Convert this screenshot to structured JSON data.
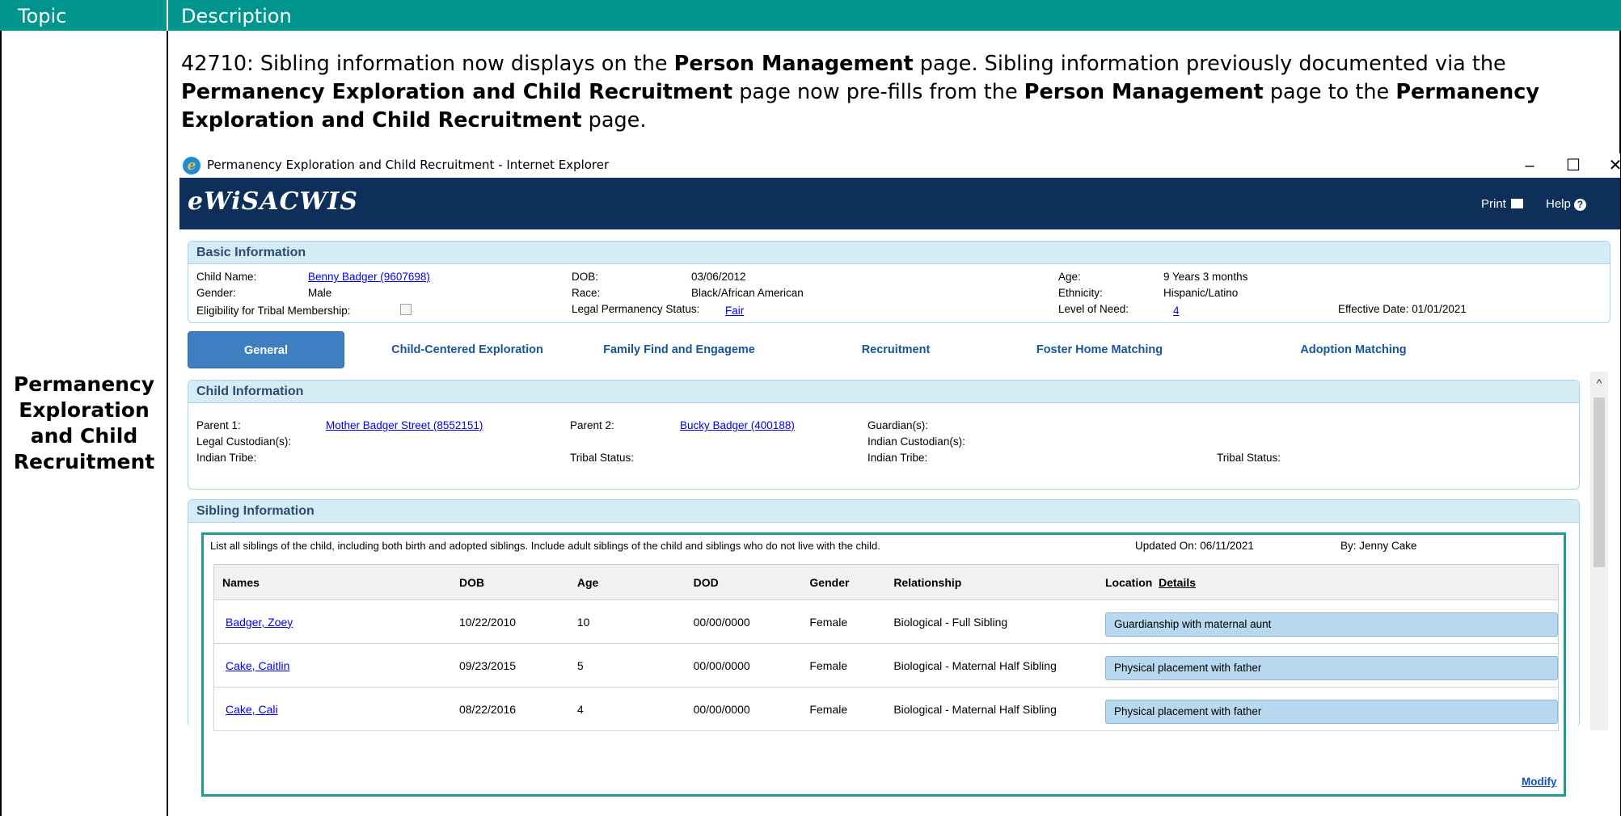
{
  "doc": {
    "header_topic": "Topic",
    "header_description": "Description",
    "topic": "Permanency Exploration and Child Recruitment",
    "topic_lines": [
      "Permanency",
      "Exploration",
      "and Child",
      "Recruitment"
    ],
    "description": {
      "p1": "42710: Sibling information now displays on the ",
      "b1": "Person Management",
      "p2": " page. Sibling information previously documented via the ",
      "b2": "Permanency Exploration and Child Recruitment",
      "p3": " page now pre-fills from the ",
      "b3": "Person Management",
      "p4": " page to the ",
      "b4": "Permanency Exploration and Child Recruitment",
      "p5": " page."
    }
  },
  "window": {
    "title": "Permanency Exploration and Child Recruitment - Internet Explorer",
    "minimize": "–",
    "maximize": "☐",
    "close": "✕"
  },
  "app": {
    "logo": "eWiSACWIS",
    "print_label": "Print",
    "help_label": "Help",
    "print_icon": "printer-icon",
    "help_icon": "question-circle-icon"
  },
  "basic": {
    "title": "Basic Information",
    "child_name_label": "Child Name:",
    "child_name": "Benny Badger (9607698)",
    "dob_label": "DOB:",
    "dob": "03/06/2012",
    "age_label": "Age:",
    "age": "9 Years 3 months",
    "gender_label": "Gender:",
    "gender": "Male",
    "race_label": "Race:",
    "race": "Black/African American",
    "ethnicity_label": "Ethnicity:",
    "ethnicity": "Hispanic/Latino",
    "tribal_label": "Eligibility for Tribal Membership:",
    "legal_perm_label": "Legal Permanency Status:",
    "legal_perm": "Fair",
    "level_label": "Level of Need:",
    "level": "4",
    "effective": "Effective Date: 01/01/2021"
  },
  "tabs": [
    {
      "label": "General",
      "active": true
    },
    {
      "label": "Child-Centered Exploration"
    },
    {
      "label": "Family Find and Engageme"
    },
    {
      "label": "Recruitment"
    },
    {
      "label": "Foster Home Matching"
    },
    {
      "label": "Adoption Matching"
    }
  ],
  "child_info": {
    "title": "Child Information",
    "parent1_label": "Parent 1:",
    "parent1": "Mother Badger Street (8552151)",
    "parent2_label": "Parent 2:",
    "parent2": "Bucky Badger (400188)",
    "guardian_label": "Guardian(s):",
    "legal_cust_label": "Legal Custodian(s):",
    "indian_cust_label": "Indian Custodian(s):",
    "indian_tribe_label": "Indian Tribe:",
    "tribal_status_label": "Tribal Status:",
    "indian_tribe2_label": "Indian Tribe:",
    "tribal_status2_label": "Tribal Status:"
  },
  "sibling": {
    "title": "Sibling Information",
    "instruction": "List all siblings of the child, including both birth and adopted siblings. Include adult siblings of the child and siblings who do not live with the child.",
    "updated_on": "Updated On:  06/11/2021",
    "by": "By:  Jenny Cake",
    "columns": [
      "Names",
      "DOB",
      "Age",
      "DOD",
      "Gender",
      "Relationship",
      "Location"
    ],
    "details_link": "Details",
    "rows": [
      {
        "name": "Badger, Zoey",
        "dob": "10/22/2010",
        "age": "10",
        "dod": "00/00/0000",
        "gender": "Female",
        "relationship": "Biological - Full Sibling",
        "location": "Guardianship with maternal aunt"
      },
      {
        "name": "Cake, Caitlin",
        "dob": "09/23/2015",
        "age": "5",
        "dod": "00/00/0000",
        "gender": "Female",
        "relationship": "Biological - Maternal Half Sibling",
        "location": "Physical placement with father"
      },
      {
        "name": "Cake, Cali",
        "dob": "08/22/2016",
        "age": "4",
        "dod": "00/00/0000",
        "gender": "Female",
        "relationship": "Biological - Maternal Half Sibling",
        "location": "Physical placement with father"
      }
    ],
    "modify": "Modify"
  }
}
